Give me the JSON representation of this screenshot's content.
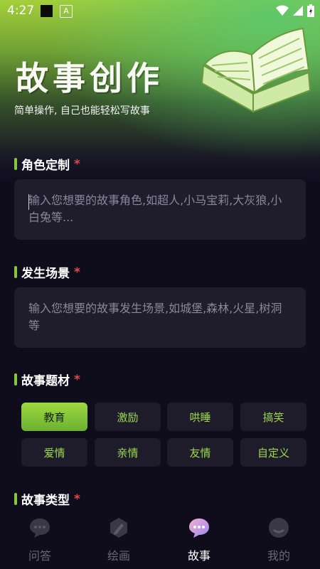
{
  "status": {
    "time": "4:27",
    "notif_letter": "A"
  },
  "header": {
    "title": "故事创作",
    "subtitle": "简单操作, 自己也能轻松写故事"
  },
  "role": {
    "label": "角色定制",
    "required": "*",
    "placeholder": "输入您想要的故事角色,如超人,小马宝莉,大灰狼,小白兔等..."
  },
  "scene": {
    "label": "发生场景",
    "required": "*",
    "placeholder": "输入您想要的故事发生场景,如城堡,森林,火星,树洞等"
  },
  "theme": {
    "label": "故事题材",
    "required": "*",
    "options": [
      "教育",
      "激励",
      "哄睡",
      "搞笑",
      "爱情",
      "亲情",
      "友情",
      "自定义"
    ],
    "selected": "教育"
  },
  "type": {
    "label": "故事类型",
    "required": "*"
  },
  "tabs": [
    {
      "label": "问答",
      "icon": "chat-bubble-icon"
    },
    {
      "label": "绘画",
      "icon": "pencil-icon"
    },
    {
      "label": "故事",
      "icon": "story-chat-icon",
      "active": true
    },
    {
      "label": "我的",
      "icon": "profile-icon"
    }
  ],
  "colors": {
    "accent": "#86c83a",
    "required_star": "#e24a4a",
    "background": "#0f0c1c"
  }
}
